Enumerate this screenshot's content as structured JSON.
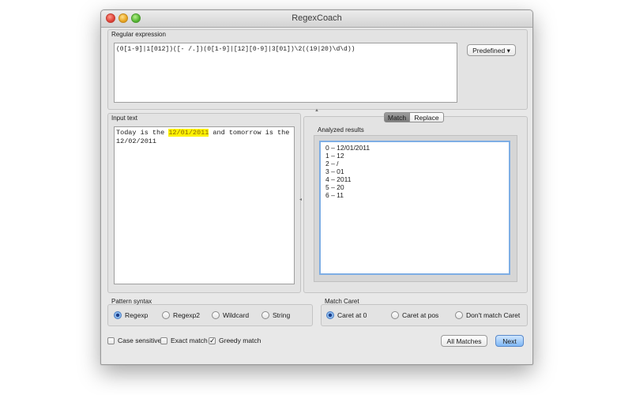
{
  "window": {
    "title": "RegexCoach"
  },
  "regex": {
    "label": "Regular expression",
    "value": "(0[1-9]|1[012])([- /.])(0[1-9]|[12][0-9]|3[01])\\2((19|20)\\d\\d))",
    "predefined_label": "Predefined ▾"
  },
  "input": {
    "label": "Input text",
    "before": "Today is the ",
    "match": "12/01/2011",
    "after": " and tomorrow is the\n12/02/2011"
  },
  "tabs": [
    "Match",
    "Replace"
  ],
  "results": {
    "label": "Analyzed results",
    "items": [
      "0 – 12/01/2011",
      "1 – 12",
      "2 – /",
      "3 – 01",
      "4 – 2011",
      "5 – 20",
      "6 – 11"
    ]
  },
  "syntax": {
    "label": "Pattern syntax",
    "options": [
      "Regexp",
      "Regexp2",
      "Wildcard",
      "String"
    ],
    "selected": 0
  },
  "caret": {
    "label": "Match Caret",
    "options": [
      "Caret at 0",
      "Caret at pos",
      "Don't match Caret"
    ],
    "selected": 0
  },
  "checks": [
    {
      "label": "Case sensitive",
      "checked": false
    },
    {
      "label": "Exact match",
      "checked": false
    },
    {
      "label": "Greedy match",
      "checked": true
    }
  ],
  "buttons": {
    "all_matches": "All Matches",
    "next": "Next"
  }
}
